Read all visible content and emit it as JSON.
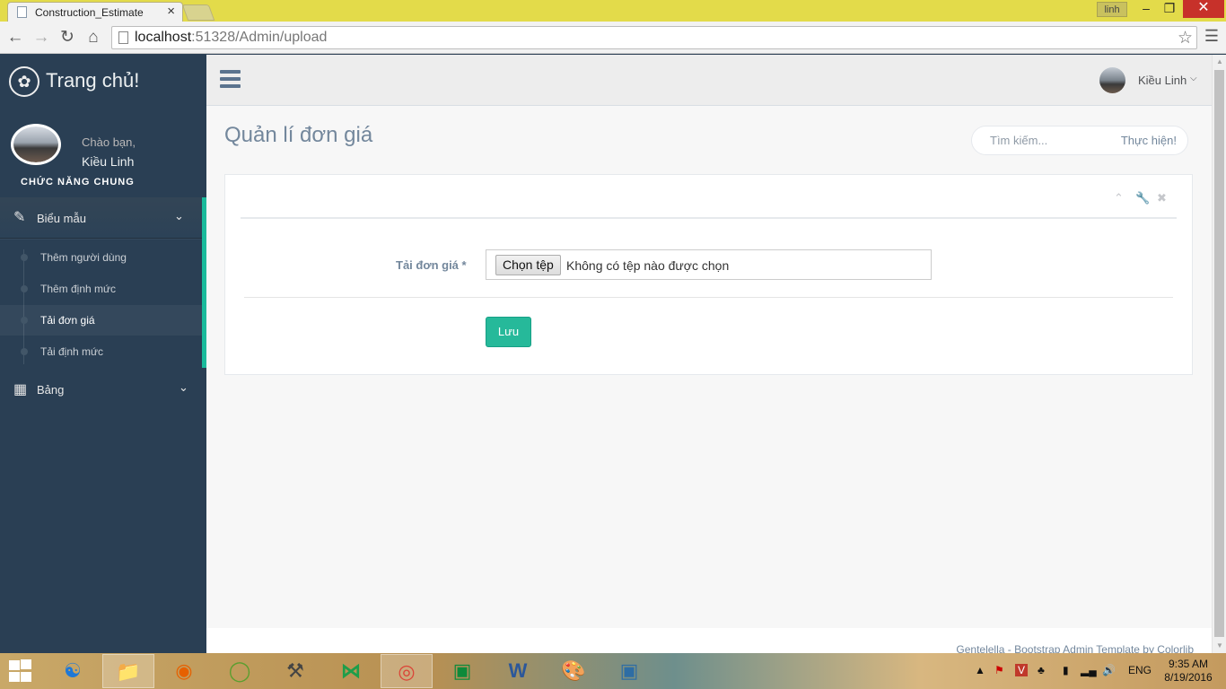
{
  "browser": {
    "tab_title": "Construction_Estimate",
    "tab_close": "×",
    "window_user": "linh",
    "url_host": "localhost",
    "url_path": ":51328/Admin/upload"
  },
  "sidebar": {
    "brand_title": "Trang chủ!",
    "greeting": "Chào bạn,",
    "user_name": "Kiều Linh",
    "section_title": "CHỨC NĂNG CHUNG",
    "menu_forms": {
      "label": "Biểu mẫu",
      "icon": "edit-icon",
      "items": [
        {
          "label": "Thêm người dùng"
        },
        {
          "label": "Thêm định mức"
        },
        {
          "label": "Tải đơn giá",
          "active": true
        },
        {
          "label": "Tải định mức"
        }
      ]
    },
    "menu_tables": {
      "label": "Bảng",
      "icon": "table-icon"
    }
  },
  "topnav": {
    "user_name": "Kiều Linh"
  },
  "main": {
    "page_title": "Quản lí đơn giá",
    "search": {
      "placeholder": "Tìm kiếm...",
      "button": "Thực hiện!"
    },
    "form": {
      "label": "Tải đơn giá",
      "required_mark": "*",
      "file_button": "Chọn tệp",
      "file_status": "Không có tệp nào được chọn",
      "save_button": "Lưu"
    }
  },
  "footer": {
    "text": "Gentelella - Bootstrap Admin Template by Colorlib"
  },
  "taskbar": {
    "language": "ENG",
    "time": "9:35 AM",
    "date": "8/19/2016"
  },
  "colors": {
    "sidebar_bg": "#2A3F54",
    "accent": "#1ABB9C",
    "save_button": "#26B99A",
    "text": "#73879C"
  }
}
